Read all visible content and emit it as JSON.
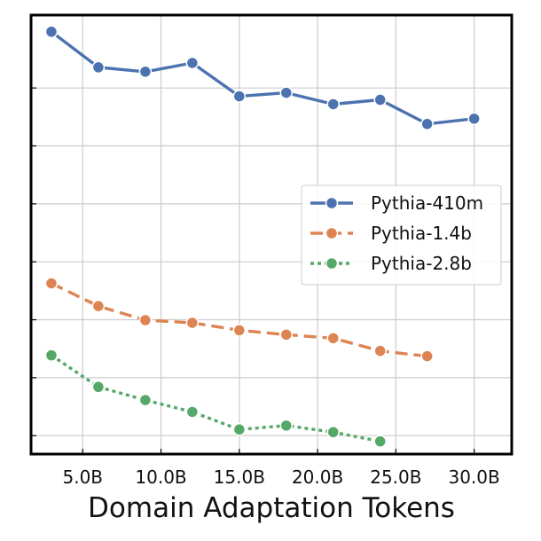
{
  "chart_data": {
    "type": "line",
    "title": "",
    "xlabel": "Domain Adaptation Tokens",
    "ylabel": "",
    "x_unit_suffix": "B",
    "x_ticks": [
      5,
      10,
      15,
      20,
      25,
      30
    ],
    "x_tick_labels": [
      "5.0B",
      "10.0B",
      "15.0B",
      "20.0B",
      "25.0B",
      "30.0B"
    ],
    "xlim": [
      1.7,
      32.4
    ],
    "ylim": [
      0,
      1
    ],
    "y_tick_labels_visible": false,
    "y_gridlines": [
      0.042,
      0.174,
      0.306,
      0.438,
      0.57,
      0.702,
      0.834
    ],
    "grid": true,
    "legend_position": "center-right",
    "series": [
      {
        "name": "Pythia-410m",
        "color": "#4c72b0",
        "dash": "solid",
        "x": [
          3,
          6,
          9,
          12,
          15,
          18,
          21,
          24,
          27,
          30
        ],
        "y": [
          0.962,
          0.881,
          0.871,
          0.891,
          0.815,
          0.823,
          0.797,
          0.807,
          0.752,
          0.764
        ]
      },
      {
        "name": "Pythia-1.4b",
        "color": "#dd8452",
        "dash": "dashed",
        "x": [
          3,
          6,
          9,
          12,
          15,
          18,
          21,
          24,
          27
        ],
        "y": [
          0.389,
          0.337,
          0.305,
          0.299,
          0.282,
          0.272,
          0.264,
          0.235,
          0.223
        ]
      },
      {
        "name": "Pythia-2.8b",
        "color": "#55a868",
        "dash": "dotted",
        "x": [
          3,
          6,
          9,
          12,
          15,
          18,
          21,
          24
        ],
        "y": [
          0.225,
          0.153,
          0.123,
          0.096,
          0.056,
          0.065,
          0.05,
          0.029
        ]
      }
    ]
  }
}
